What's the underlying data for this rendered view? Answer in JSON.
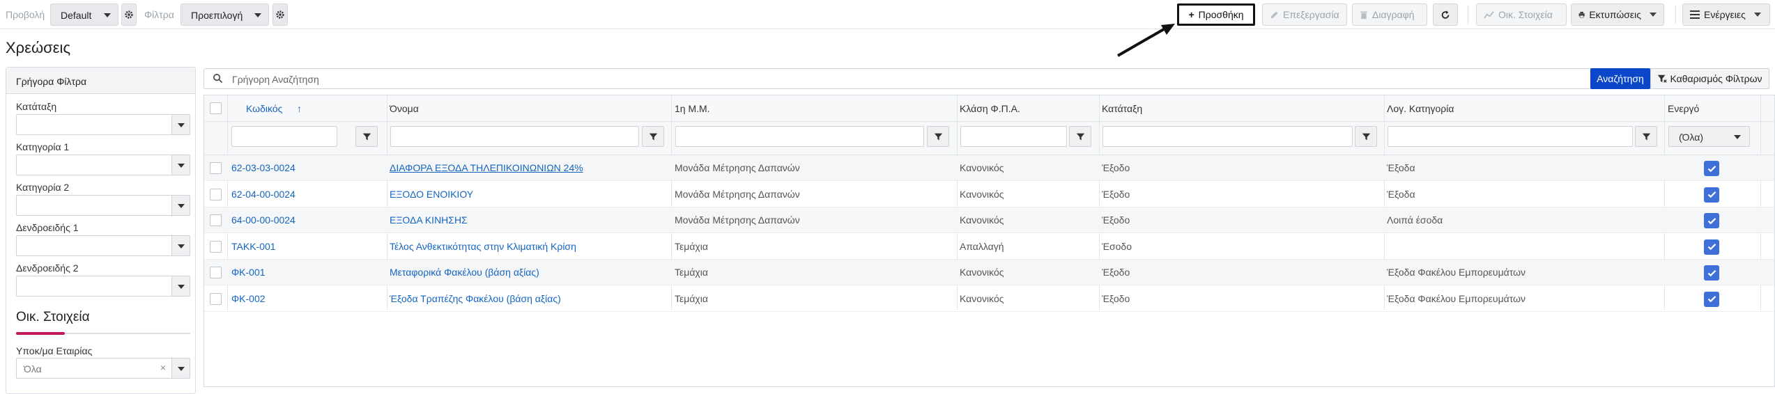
{
  "toolbar": {
    "view_label": "Προβολή",
    "view_value": "Default",
    "filter_label": "Φίλτρα",
    "filter_value": "Προεπιλογή",
    "add": "Προσθήκη",
    "edit": "Επεξεργασία",
    "delete": "Διαγραφή",
    "financial": "Οικ. Στοιχεία",
    "prints": "Εκτυπώσεις",
    "actions": "Ενέργειες"
  },
  "page": {
    "title": "Χρεώσεις"
  },
  "sidebar": {
    "title": "Γρήγορα Φίλτρα",
    "filters": [
      {
        "label": "Κατάταξη"
      },
      {
        "label": "Κατηγορία 1"
      },
      {
        "label": "Κατηγορία 2"
      },
      {
        "label": "Δενδροειδής 1"
      },
      {
        "label": "Δενδροειδής 2"
      }
    ],
    "section_title": "Οικ. Στοιχεία",
    "company_label": "Υποκ/μα Εταιρίας",
    "company_value": "Όλα",
    "company_clear": "×"
  },
  "search": {
    "placeholder": "Γρήγορη Αναζήτηση",
    "button": "Αναζήτηση",
    "clear": "Καθαρισμός Φίλτρων"
  },
  "table": {
    "columns": [
      "Κωδικός",
      "Όνομα",
      "1η Μ.Μ.",
      "Κλάση Φ.Π.Α.",
      "Κατάταξη",
      "Λογ. Κατηγορία",
      "Ενεργό"
    ],
    "sort_arrow": "↑",
    "active_filter": "(Όλα)",
    "rows": [
      {
        "code": "62-03-03-0024",
        "name": "ΔΙΑΦΟΡΑ ΕΞΟΔΑ ΤΗΛΕΠΙΚΟΙΝΩΝΙΩΝ 24%",
        "unit": "Μονάδα Μέτρησης Δαπανών",
        "vat": "Κανονικός",
        "class": "Έξοδο",
        "category": "Έξοδα"
      },
      {
        "code": "62-04-00-0024",
        "name": "ΕΞΟΔΟ ΕΝΟΙΚΙΟΥ",
        "unit": "Μονάδα Μέτρησης Δαπανών",
        "vat": "Κανονικός",
        "class": "Έξοδο",
        "category": "Έξοδα"
      },
      {
        "code": "64-00-00-0024",
        "name": "ΕΞΟΔΑ ΚΙΝΗΣΗΣ",
        "unit": "Μονάδα Μέτρησης Δαπανών",
        "vat": "Κανονικός",
        "class": "Έξοδο",
        "category": "Λοιπά έσοδα"
      },
      {
        "code": "ΤΑΚΚ-001",
        "name": "Τέλος Ανθεκτικότητας στην Κλιματική Κρίση",
        "unit": "Τεμάχια",
        "vat": "Απαλλαγή",
        "class": "Έσοδο",
        "category": ""
      },
      {
        "code": "ΦΚ-001",
        "name": "Μεταφορικά Φακέλου (βάση αξίας)",
        "unit": "Τεμάχια",
        "vat": "Κανονικός",
        "class": "Έξοδο",
        "category": "Έξοδα Φακέλου Εμπορευμάτων"
      },
      {
        "code": "ΦΚ-002",
        "name": "Έξοδα Τραπέζης Φακέλου (βάση αξίας)",
        "unit": "Τεμάχια",
        "vat": "Κανονικός",
        "class": "Έξοδο",
        "category": "Έξοδα Φακέλου Εμπορευμάτων"
      }
    ]
  },
  "colors": {
    "accent": "#0d47c9",
    "link": "#1565c0",
    "checkbox": "#3f6fd9",
    "section_underline": "#c2185b"
  }
}
